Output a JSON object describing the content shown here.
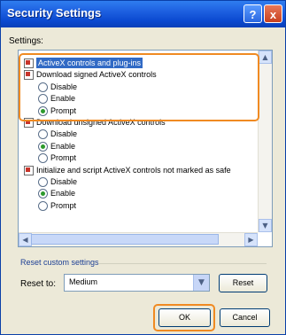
{
  "window": {
    "title": "Security Settings",
    "help_label": "?",
    "close_label": "x"
  },
  "settings_label": "Settings:",
  "tree": [
    {
      "type": "checkbox",
      "label": "ActiveX controls and plug-ins",
      "selected": true
    },
    {
      "type": "checkbox",
      "label": "Download signed ActiveX controls"
    },
    {
      "type": "radio",
      "label": "Disable",
      "checked": false
    },
    {
      "type": "radio",
      "label": "Enable",
      "checked": false
    },
    {
      "type": "radio",
      "label": "Prompt",
      "checked": true
    },
    {
      "type": "checkbox",
      "label": "Download unsigned ActiveX controls"
    },
    {
      "type": "radio",
      "label": "Disable",
      "checked": false
    },
    {
      "type": "radio",
      "label": "Enable",
      "checked": true
    },
    {
      "type": "radio",
      "label": "Prompt",
      "checked": false
    },
    {
      "type": "checkbox",
      "label": "Initialize and script ActiveX controls not marked as safe"
    },
    {
      "type": "radio",
      "label": "Disable",
      "checked": false
    },
    {
      "type": "radio",
      "label": "Enable",
      "checked": true
    },
    {
      "type": "radio",
      "label": "Prompt",
      "checked": false
    }
  ],
  "reset_group": {
    "label": "Reset custom settings",
    "reset_to_label": "Reset to:",
    "level_value": "Medium",
    "reset_button": "Reset"
  },
  "buttons": {
    "ok": "OK",
    "cancel": "Cancel"
  },
  "colors": {
    "highlight_box": "#f08a22",
    "title_bar": "#0b49d0",
    "selection": "#316ac5"
  },
  "icons": {
    "checkbox": "checkbox-icon",
    "radio": "radio-icon",
    "scroll_up": "scroll-up-icon",
    "scroll_down": "scroll-down-icon",
    "scroll_left": "scroll-left-icon",
    "scroll_right": "scroll-right-icon",
    "dropdown": "chevron-down-icon"
  }
}
